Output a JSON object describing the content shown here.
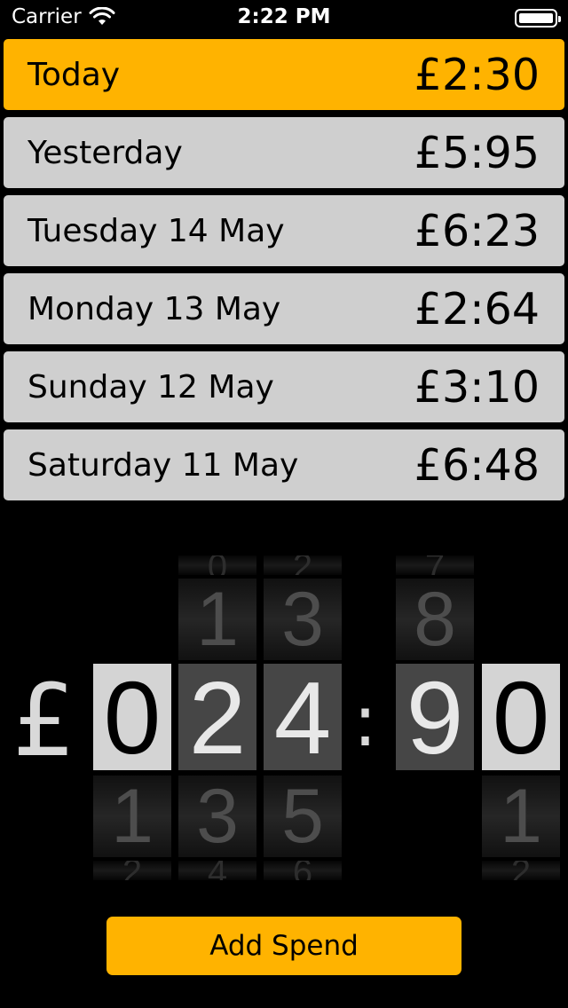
{
  "status_bar": {
    "carrier": "Carrier",
    "time": "2:22 PM"
  },
  "days": [
    {
      "label": "Today",
      "amount": "£2:30",
      "active": true
    },
    {
      "label": "Yesterday",
      "amount": "£5:95",
      "active": false
    },
    {
      "label": "Tuesday 14 May",
      "amount": "£6:23",
      "active": false
    },
    {
      "label": "Monday 13 May",
      "amount": "£2:64",
      "active": false
    },
    {
      "label": "Sunday 12 May",
      "amount": "£3:10",
      "active": false
    },
    {
      "label": "Saturday 11 May",
      "amount": "£6:48",
      "active": false
    }
  ],
  "odometer": {
    "currency": "£",
    "separator": ":",
    "wheels": [
      {
        "current": "0",
        "prev": "",
        "far_prev": "",
        "next": "1",
        "far_next": "2",
        "style": "light"
      },
      {
        "current": "2",
        "prev": "1",
        "far_prev": "0",
        "next": "3",
        "far_next": "4",
        "style": "dark"
      },
      {
        "current": "4",
        "prev": "3",
        "far_prev": "2",
        "next": "5",
        "far_next": "6",
        "style": "dark"
      },
      {
        "current": "9",
        "prev": "8",
        "far_prev": "7",
        "next": "",
        "far_next": "",
        "style": "dark"
      },
      {
        "current": "0",
        "prev": "",
        "far_prev": "",
        "next": "1",
        "far_next": "2",
        "style": "light"
      }
    ]
  },
  "add_spend_label": "Add Spend",
  "colors": {
    "accent": "#ffb300",
    "row": "#cfcfcf",
    "background": "#000000"
  }
}
